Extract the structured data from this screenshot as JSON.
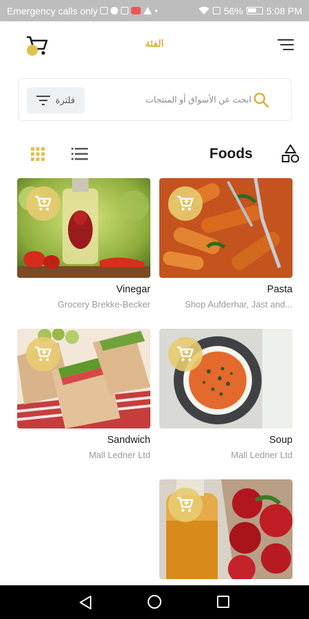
{
  "status_bar": {
    "carrier_text": "Emergency calls only",
    "battery": "56%",
    "time": "5:08 PM"
  },
  "header": {
    "title": "الفئة",
    "cart_icon": "cart-icon",
    "menu_icon": "menu-icon"
  },
  "search": {
    "placeholder": "ابحث عن الأسواق أو المنتجات",
    "filter_label": "فلترة",
    "search_icon": "search-icon",
    "filter_icon": "filter-icon"
  },
  "toolbar": {
    "title": "Foods",
    "grid_icon": "grid-view-icon",
    "list_icon": "list-view-icon",
    "category_icon": "shapes-icon"
  },
  "products": [
    {
      "name": "Vinegar",
      "shop": "Grocery Brekke-Becker"
    },
    {
      "name": "Pasta",
      "shop": "Shop Aufderhar, Jast and..."
    },
    {
      "name": "Sandwich",
      "shop": "Mall Ledner Ltd"
    },
    {
      "name": "Soup",
      "shop": "Mall Ledner Ltd"
    },
    {
      "name": "",
      "shop": ""
    }
  ],
  "colors": {
    "accent": "#d7b03a",
    "cart_circle": "#e7cb70"
  }
}
